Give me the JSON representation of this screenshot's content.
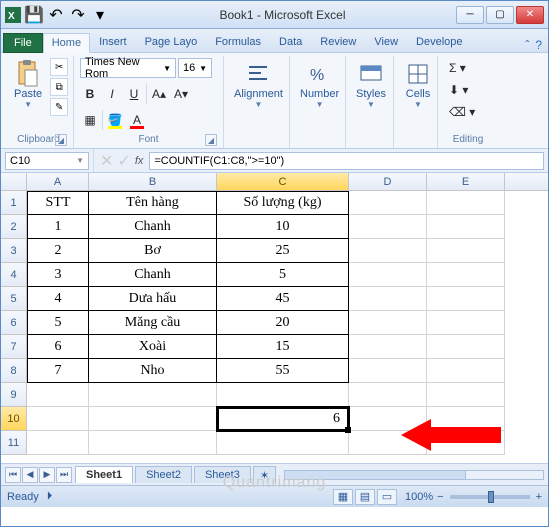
{
  "title": "Book1 - Microsoft Excel",
  "qat": {
    "save": "💾",
    "undo": "↶",
    "redo": "↷"
  },
  "tabs": {
    "file": "File",
    "home": "Home",
    "insert": "Insert",
    "pagelayout": "Page Layo",
    "formulas": "Formulas",
    "data": "Data",
    "review": "Review",
    "view": "View",
    "developer": "Develope"
  },
  "ribbon": {
    "clipboard": {
      "paste": "Paste",
      "label": "Clipboard"
    },
    "font": {
      "name": "Times New Rom",
      "size": "16",
      "label": "Font"
    },
    "alignment": {
      "label": "Alignment"
    },
    "number": {
      "label": "Number"
    },
    "styles": {
      "label": "Styles"
    },
    "cells": {
      "label": "Cells"
    },
    "editing": {
      "label": "Editing"
    }
  },
  "namebox": "C10",
  "formula": "=COUNTIF(C1:C8,\">=10\")",
  "columns": [
    "A",
    "B",
    "C",
    "D",
    "E"
  ],
  "rowheads": [
    "1",
    "2",
    "3",
    "4",
    "5",
    "6",
    "7",
    "8",
    "9",
    "10",
    "11"
  ],
  "table": {
    "header": {
      "a": "STT",
      "b": "Tên hàng",
      "c": "Số lượng (kg)"
    },
    "rows": [
      {
        "a": "1",
        "b": "Chanh",
        "c": "10"
      },
      {
        "a": "2",
        "b": "Bơ",
        "c": "25"
      },
      {
        "a": "3",
        "b": "Chanh",
        "c": "5"
      },
      {
        "a": "4",
        "b": "Dưa hấu",
        "c": "45"
      },
      {
        "a": "5",
        "b": "Măng cầu",
        "c": "20"
      },
      {
        "a": "6",
        "b": "Xoài",
        "c": "15"
      },
      {
        "a": "7",
        "b": "Nho",
        "c": "55"
      }
    ]
  },
  "result_c10": "6",
  "sheets": {
    "s1": "Sheet1",
    "s2": "Sheet2",
    "s3": "Sheet3"
  },
  "status": {
    "ready": "Ready",
    "zoom": "100%",
    "macro": "⏵"
  },
  "watermark": "Quantrimang"
}
